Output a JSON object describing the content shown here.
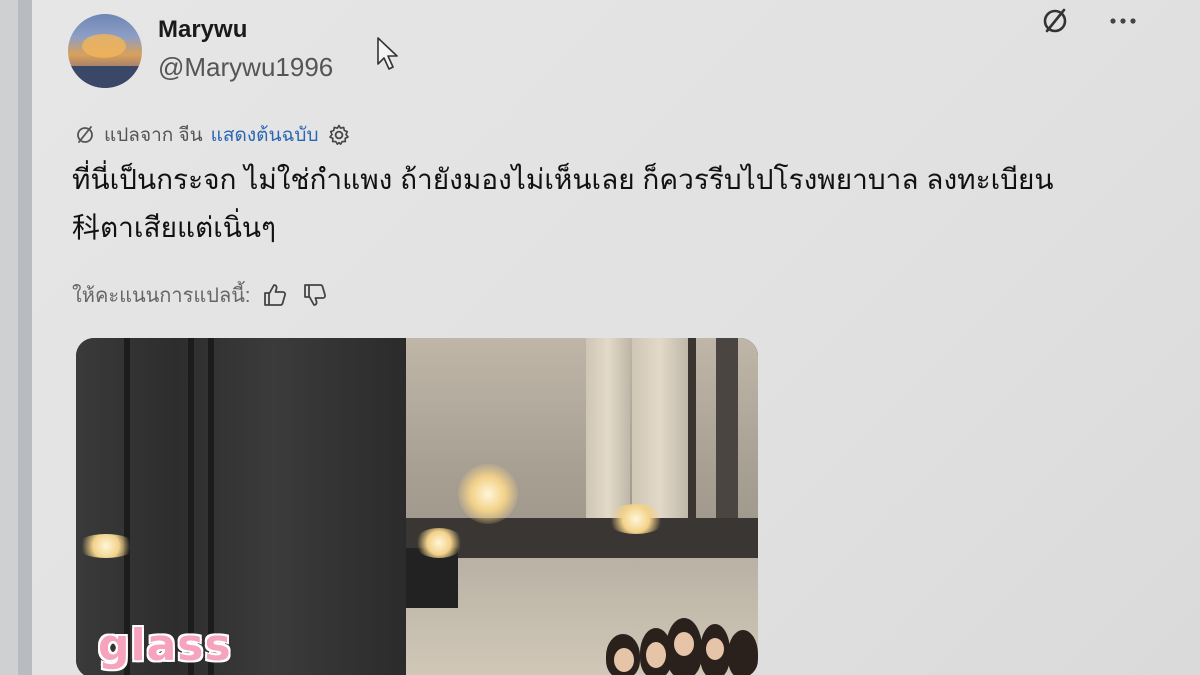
{
  "author": {
    "display_name": "Marywu",
    "handle": "@Marywu1996"
  },
  "translation": {
    "translated_from": "แปลจาก จีน",
    "show_original": "แสดงต้นฉบับ"
  },
  "post": {
    "line1": "ที่นี่เป็นกระจก ไม่ใช่กำแพง ถ้ายังมองไม่เห็นเลย ก็ควรรีบไปโรงพยาบาล ลงทะเบียน",
    "line2": "科ตาเสียแต่เนิ่นๆ"
  },
  "rating": {
    "prompt": "ให้คะแนนการแปลนี้:"
  },
  "media": {
    "overlay_text": "glass"
  },
  "icons": {
    "translate": "translate-icon",
    "more": "more-icon",
    "settings": "gear-icon",
    "thumbs_up": "thumbs-up-icon",
    "thumbs_down": "thumbs-down-icon"
  },
  "colors": {
    "link": "#2a66b3",
    "overlay_text": "#f6a3bd"
  }
}
